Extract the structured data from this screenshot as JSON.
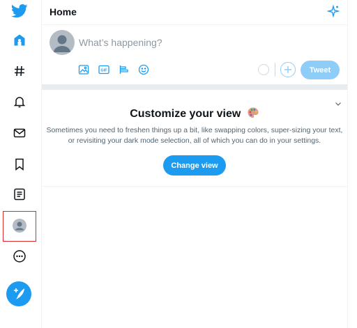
{
  "header": {
    "title": "Home"
  },
  "composer": {
    "placeholder": "What’s happening?",
    "tweet_label": "Tweet"
  },
  "customize_card": {
    "title": "Customize your view",
    "text": "Sometimes you need to freshen things up a bit, like swapping colors, super-sizing your text, or revisiting your dark mode selection, all of which you can do in your settings.",
    "button_label": "Change view"
  },
  "icons": [
    "twitter-logo-icon",
    "home-icon",
    "explore-hashtag-icon",
    "notifications-bell-icon",
    "messages-envelope-icon",
    "bookmarks-icon",
    "lists-icon",
    "profile-avatar-icon",
    "more-options-icon",
    "compose-tweet-icon",
    "sparkle-icon",
    "image-icon",
    "gif-icon",
    "poll-icon",
    "emoji-icon",
    "chevron-down-icon",
    "palette-icon"
  ],
  "colors": {
    "brand": "#1d9bf0",
    "tweet_disabled": "#8ecdf8",
    "selection_outline": "#e0262b"
  }
}
